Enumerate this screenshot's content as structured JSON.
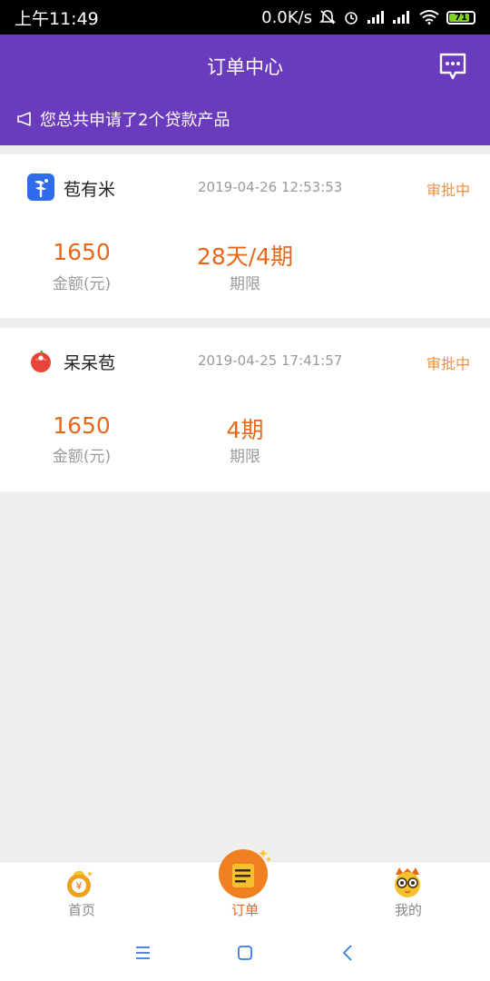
{
  "status_bar": {
    "time": "上午11:49",
    "net_speed": "0.0K/s",
    "battery": "71"
  },
  "header": {
    "title": "订单中心",
    "notice": "您总共申请了2个贷款产品"
  },
  "orders": [
    {
      "name": "苞有米",
      "time": "2019-04-26 12:53:53",
      "status": "审批中",
      "amount": "1650",
      "amount_label": "金额(元)",
      "term": "28天/4期",
      "term_label": "期限"
    },
    {
      "name": "呆呆苞",
      "time": "2019-04-25 17:41:57",
      "status": "审批中",
      "amount": "1650",
      "amount_label": "金额(元)",
      "term": "4期",
      "term_label": "期限"
    }
  ],
  "tabs": [
    {
      "label": "首页",
      "icon": "money-bag-icon"
    },
    {
      "label": "订单",
      "icon": "order-scroll-icon",
      "active": true
    },
    {
      "label": "我的",
      "icon": "owl-face-icon"
    }
  ],
  "colors": {
    "header_bg": "#6b3bbd",
    "accent_orange": "#e8681a",
    "status_orange": "#ef8f3a"
  }
}
